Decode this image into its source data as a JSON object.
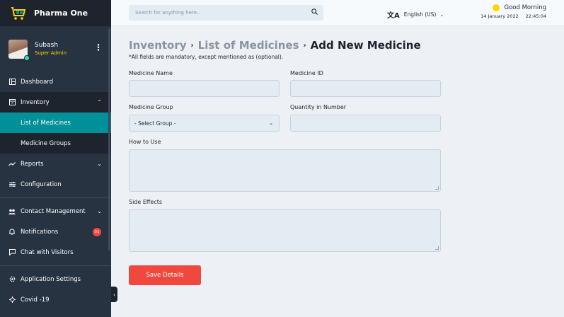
{
  "brand": {
    "name": "Pharma One"
  },
  "user": {
    "name": "Subash",
    "role": "Super Admin"
  },
  "nav": {
    "dashboard": "Dashboard",
    "inventory": "Inventory",
    "list_of_medicines": "List of Medicines",
    "medicine_groups": "Medicine Groups",
    "reports": "Reports",
    "configuration": "Configuration",
    "contact_management": "Contact Management",
    "notifications": "Notifications",
    "notifications_badge": "01",
    "chat_with_visitors": "Chat with Visitors",
    "application_settings": "Application Settings",
    "covid": "Covid -19"
  },
  "topbar": {
    "search_placeholder": "Search for anything here..",
    "language": "English (US)",
    "greeting": "Good Morning",
    "date": "14 January 2022",
    "time": "22:45:04"
  },
  "page": {
    "breadcrumb_1": "Inventory",
    "breadcrumb_2": "List of Medicines",
    "title": "Add New Medicine",
    "note": "*All fields are mandatory, except mentioned as (optional)."
  },
  "form": {
    "medicine_name_label": "Medicine Name",
    "medicine_name_value": "",
    "medicine_id_label": "Medicine ID",
    "medicine_id_value": "",
    "medicine_group_label": "Medicine Group",
    "medicine_group_selected": "- Select Group -",
    "quantity_label": "Quantity in Number",
    "quantity_value": "",
    "how_to_use_label": "How to Use",
    "side_effects_label": "Side Effects",
    "save_label": "Save Details"
  },
  "colors": {
    "sidebar_bg": "#283342",
    "sidebar_dark": "#1d242e",
    "active_item": "#009099",
    "accent_yellow": "#fed600",
    "save_button": "#f0483e",
    "page_bg": "#edf1f5"
  },
  "icons": [
    "cart-logo-icon",
    "kebab-menu-icon",
    "dashboard-icon",
    "inventory-icon",
    "reports-icon",
    "configuration-icon",
    "contacts-icon",
    "bell-icon",
    "chat-icon",
    "settings-icon",
    "covid-icon",
    "search-icon",
    "translate-icon",
    "sun-icon",
    "chevron-down-icon",
    "chevron-up-icon",
    "chevron-left-icon"
  ]
}
